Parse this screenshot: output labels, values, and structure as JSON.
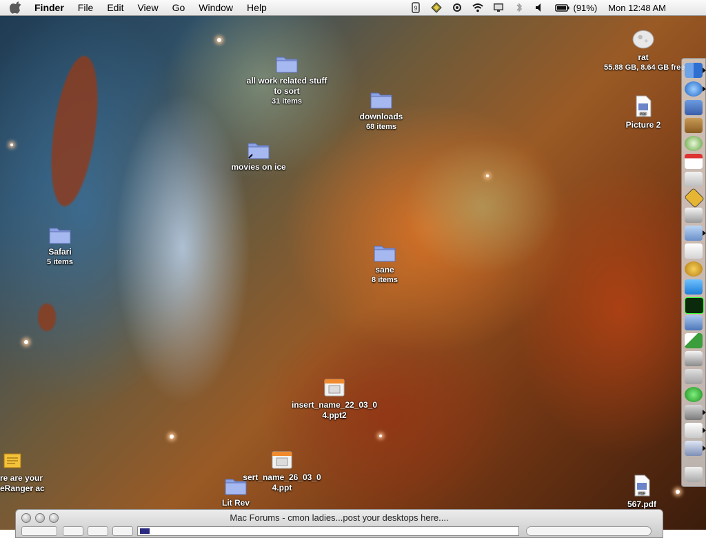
{
  "menubar": {
    "app_name": "Finder",
    "menus": [
      "File",
      "Edit",
      "View",
      "Go",
      "Window",
      "Help"
    ],
    "battery_text": "(91%)",
    "clock": "Mon 12:48 AM",
    "status_icons": [
      "ichat-icon",
      "wireless-icon",
      "display-icon",
      "bluetooth-icon",
      "volume-icon",
      "battery-icon"
    ]
  },
  "desktop": {
    "icons": [
      {
        "label": "all work related stuff\nto sort",
        "sub": "31 items"
      },
      {
        "label": "downloads",
        "sub": "68 items"
      },
      {
        "label": "movies on ice",
        "sub": ""
      },
      {
        "label": "Safari",
        "sub": "5 items"
      },
      {
        "label": "sane",
        "sub": "8 items"
      },
      {
        "label": "insert_name_22_03_0\n4.ppt2",
        "sub": ""
      },
      {
        "label": "sert_name_26_03_0\n4.ppt",
        "sub": ""
      },
      {
        "label": "Lit Rev",
        "sub": ""
      },
      {
        "label": "re are your\neRanger ac",
        "sub": ""
      },
      {
        "label": "rat",
        "sub": "55.88 GB, 8.64 GB free"
      },
      {
        "label": "Picture 2",
        "sub": ""
      },
      {
        "label": "567.pdf",
        "sub": ""
      }
    ]
  },
  "window": {
    "title": "Mac Forums - cmon ladies...post your desktops here...."
  },
  "colors": {
    "menubar_bg": "#ececec",
    "folder_blue": "#8fa3e6"
  }
}
